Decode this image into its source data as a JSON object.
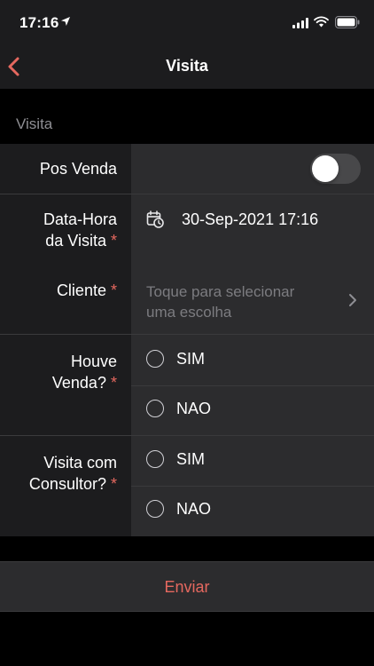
{
  "status_bar": {
    "time": "17:16",
    "icons": [
      "location-arrow-icon",
      "signal-icon",
      "wifi-icon",
      "battery-icon"
    ]
  },
  "nav": {
    "title": "Visita",
    "back_icon": "chevron-left-icon"
  },
  "section": {
    "title": "Visita"
  },
  "fields": {
    "pos_venda": {
      "label": "Pos Venda",
      "value": false
    },
    "data_hora": {
      "label_line1": "Data-Hora",
      "label_line2": "da Visita",
      "required_mark": "*",
      "value": "30-Sep-2021 17:16",
      "icon": "calendar-clock-icon"
    },
    "cliente": {
      "label": "Cliente",
      "required_mark": "*",
      "placeholder_line1": "Toque para selecionar",
      "placeholder_line2": "uma escolha",
      "icon": "chevron-right-icon"
    },
    "houve_venda": {
      "label_line1": "Houve",
      "label_line2": "Venda?",
      "required_mark": "*",
      "options": [
        "SIM",
        "NAO"
      ],
      "selected": null
    },
    "visita_consultor": {
      "label_line1": "Visita com",
      "label_line2": "Consultor?",
      "required_mark": "*",
      "options": [
        "SIM",
        "NAO"
      ],
      "selected": null
    }
  },
  "submit": {
    "label": "Enviar"
  },
  "colors": {
    "accent": "#e5685f",
    "background": "#000000",
    "label_column": "#1c1c1e",
    "value_column": "#2c2c2e",
    "placeholder": "#7c7c80"
  }
}
